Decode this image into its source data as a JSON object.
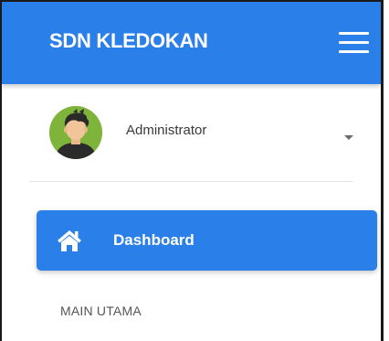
{
  "header": {
    "brand": "SDN KLEDOKAN",
    "menu_icon": "hamburger-icon",
    "color": "#2a7fe8"
  },
  "user": {
    "name": "Administrator",
    "avatar_icon": "user-avatar-icon",
    "dropdown_icon": "caret-down-icon"
  },
  "nav": {
    "items": [
      {
        "label": "Dashboard",
        "icon": "home-icon",
        "active": true
      }
    ],
    "sections": [
      {
        "label": "MAIN UTAMA"
      }
    ]
  }
}
